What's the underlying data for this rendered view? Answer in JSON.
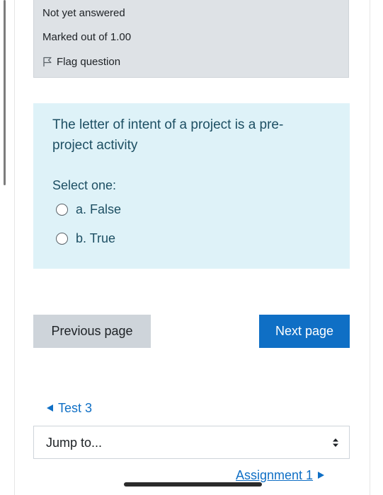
{
  "question_info": {
    "state": "Not yet answered",
    "marks": "Marked out of 1.00",
    "flag_label": "Flag question"
  },
  "question": {
    "text": "The letter of intent of a project is a pre-project activity",
    "prompt": "Select one:",
    "options": [
      {
        "label": "a. False",
        "selected": false
      },
      {
        "label": "b. True",
        "selected": false
      }
    ]
  },
  "navigation": {
    "previous_label": "Previous page",
    "next_label": "Next page"
  },
  "activity_nav": {
    "previous_activity": "Test 3",
    "jump_placeholder": "Jump to...",
    "next_activity": "Assignment 1"
  },
  "colors": {
    "info_bg": "#dee2e6",
    "question_bg": "#def2f8",
    "primary": "#0f6fc5"
  }
}
